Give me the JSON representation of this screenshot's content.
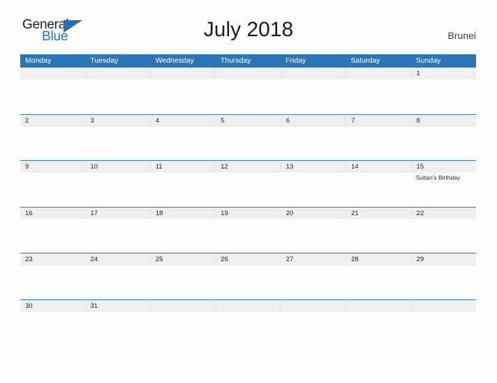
{
  "logo": {
    "line1": "General",
    "line2": "Blue",
    "triangle_icon": "triangle-icon",
    "color_text": "#231f20",
    "color_blue": "#2470b8"
  },
  "header": {
    "title": "July 2018",
    "country": "Brunei"
  },
  "theme": {
    "header_blue": "#2e75b6",
    "band_gray": "#efefef",
    "page_background": "#fdfdfd",
    "text_dark": "#262626"
  },
  "calendar": {
    "weekdays": [
      "Monday",
      "Tuesday",
      "Wednesday",
      "Thursday",
      "Friday",
      "Saturday",
      "Sunday"
    ],
    "weeks": [
      {
        "days": [
          {
            "num": "",
            "event": ""
          },
          {
            "num": "",
            "event": ""
          },
          {
            "num": "",
            "event": ""
          },
          {
            "num": "",
            "event": ""
          },
          {
            "num": "",
            "event": ""
          },
          {
            "num": "",
            "event": ""
          },
          {
            "num": "1",
            "event": ""
          }
        ]
      },
      {
        "days": [
          {
            "num": "2",
            "event": ""
          },
          {
            "num": "3",
            "event": ""
          },
          {
            "num": "4",
            "event": ""
          },
          {
            "num": "5",
            "event": ""
          },
          {
            "num": "6",
            "event": ""
          },
          {
            "num": "7",
            "event": ""
          },
          {
            "num": "8",
            "event": ""
          }
        ]
      },
      {
        "days": [
          {
            "num": "9",
            "event": ""
          },
          {
            "num": "10",
            "event": ""
          },
          {
            "num": "11",
            "event": ""
          },
          {
            "num": "12",
            "event": ""
          },
          {
            "num": "13",
            "event": ""
          },
          {
            "num": "14",
            "event": ""
          },
          {
            "num": "15",
            "event": "Sultan's Birthday"
          }
        ]
      },
      {
        "days": [
          {
            "num": "16",
            "event": ""
          },
          {
            "num": "17",
            "event": ""
          },
          {
            "num": "18",
            "event": ""
          },
          {
            "num": "19",
            "event": ""
          },
          {
            "num": "20",
            "event": ""
          },
          {
            "num": "21",
            "event": ""
          },
          {
            "num": "22",
            "event": ""
          }
        ]
      },
      {
        "days": [
          {
            "num": "23",
            "event": ""
          },
          {
            "num": "24",
            "event": ""
          },
          {
            "num": "25",
            "event": ""
          },
          {
            "num": "26",
            "event": ""
          },
          {
            "num": "27",
            "event": ""
          },
          {
            "num": "28",
            "event": ""
          },
          {
            "num": "29",
            "event": ""
          }
        ]
      },
      {
        "days": [
          {
            "num": "30",
            "event": ""
          },
          {
            "num": "31",
            "event": ""
          },
          {
            "num": "",
            "event": ""
          },
          {
            "num": "",
            "event": ""
          },
          {
            "num": "",
            "event": ""
          },
          {
            "num": "",
            "event": ""
          },
          {
            "num": "",
            "event": ""
          }
        ]
      }
    ]
  }
}
